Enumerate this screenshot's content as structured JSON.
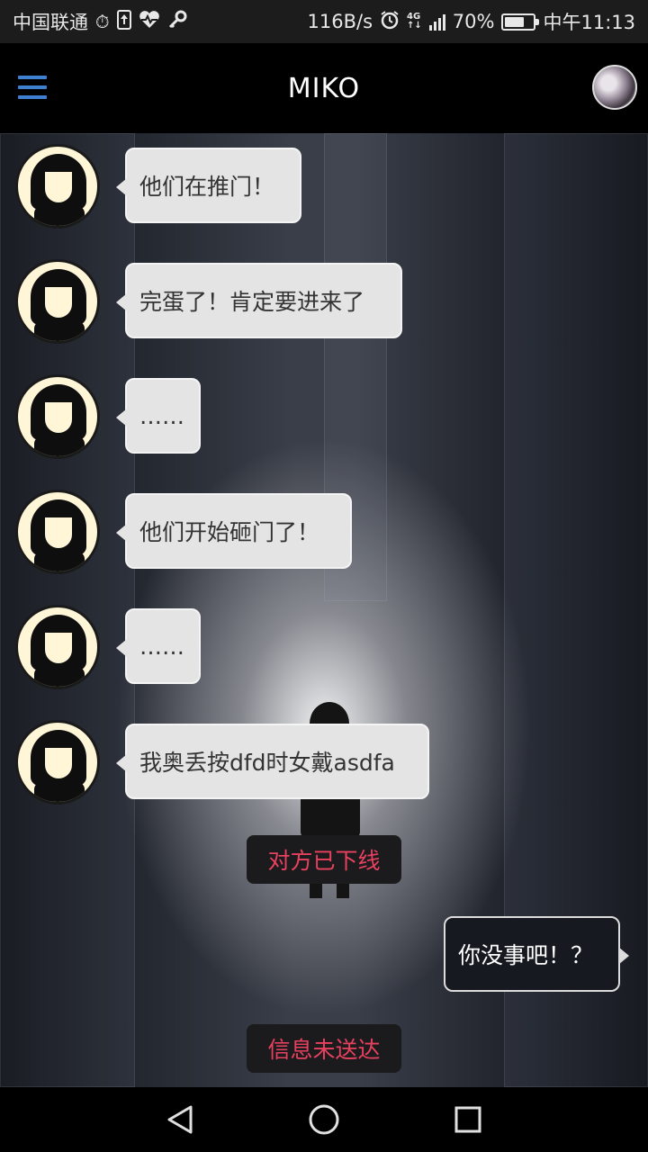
{
  "status_bar": {
    "carrier": "中国联通",
    "speed": "116B/s",
    "battery": "70%",
    "battery_level": 0.7,
    "time": "中午11:13",
    "icons": [
      "timer-icon",
      "upload-icon",
      "heart-rate-icon",
      "key-icon",
      "alarm-icon",
      "4g-icon",
      "signal-icon",
      "battery-icon"
    ]
  },
  "header": {
    "title": "MIKO",
    "menu_icon": "hamburger-menu-icon",
    "accent_color": "#3f7fd0"
  },
  "messages": [
    {
      "sender": "miko",
      "text": "他们在推门！"
    },
    {
      "sender": "miko",
      "text": "完蛋了！肯定要进来了"
    },
    {
      "sender": "miko",
      "text": "……"
    },
    {
      "sender": "miko",
      "text": "他们开始砸门了！"
    },
    {
      "sender": "miko",
      "text": "……"
    },
    {
      "sender": "miko",
      "text": "我奥丢按dfd时女戴asdfa"
    }
  ],
  "notices": {
    "offline": "对方已下线",
    "undelivered": "信息未送达"
  },
  "outgoing_message": {
    "sender": "me",
    "text": "你没事吧！？"
  },
  "notice_color": "#e8415f",
  "nav_bar": {
    "back_icon": "back-triangle-icon",
    "home_icon": "home-circle-icon",
    "recents_icon": "recents-square-icon"
  }
}
